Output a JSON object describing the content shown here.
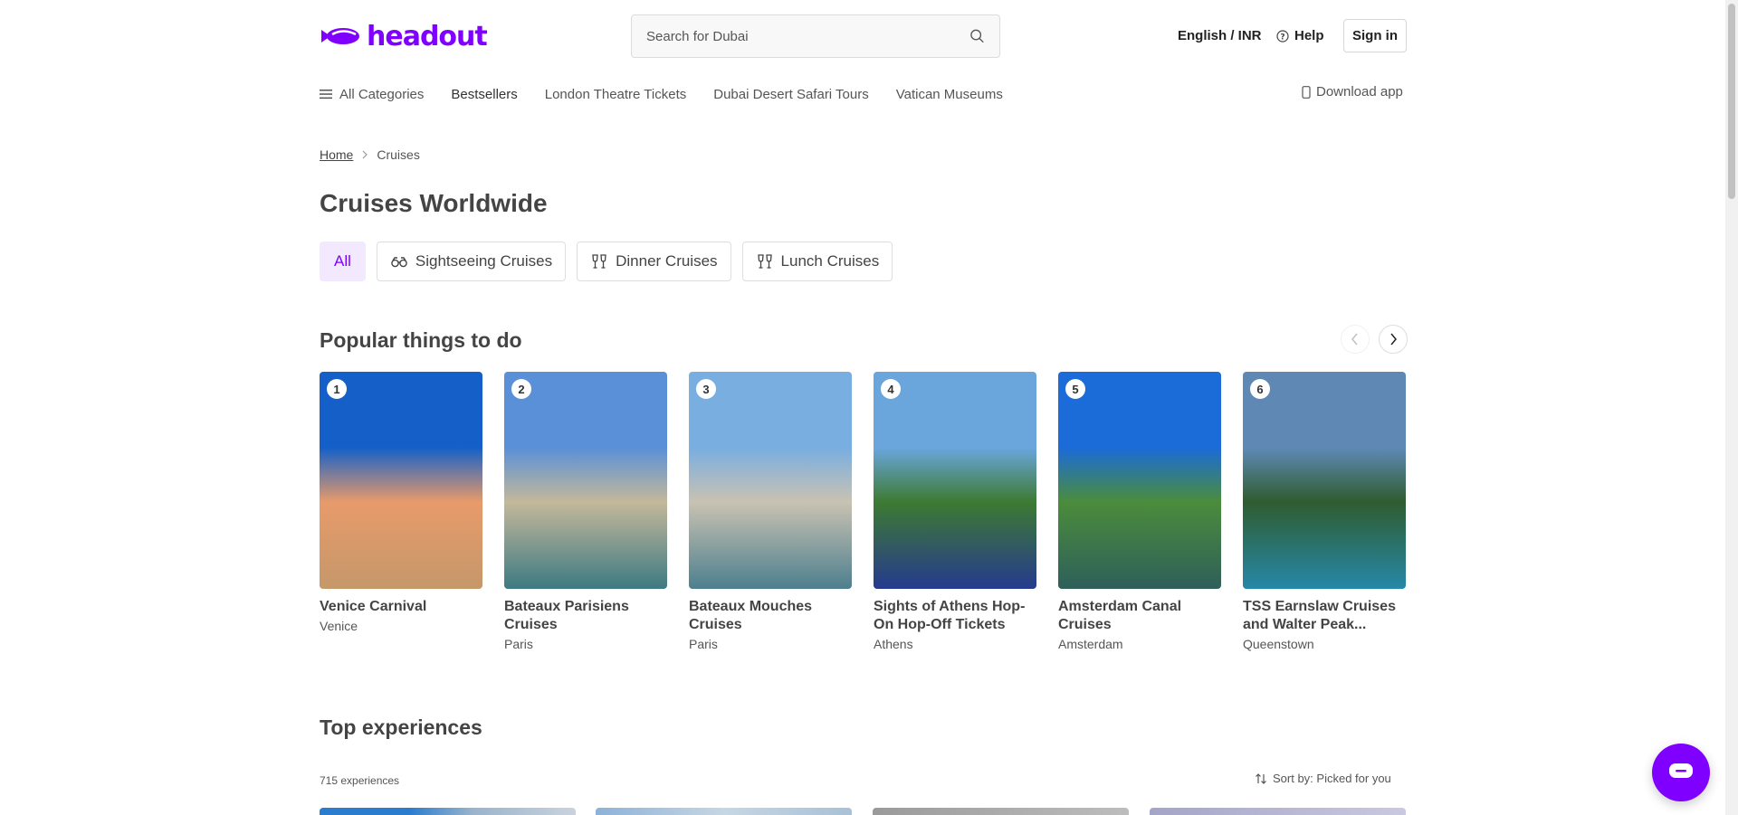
{
  "header": {
    "logo_text": "headout",
    "search_placeholder": "Search for Dubai",
    "language": "English / INR",
    "help": "Help",
    "sign_in": "Sign in"
  },
  "nav": {
    "all_categories": "All Categories",
    "items": [
      "Bestsellers",
      "London Theatre Tickets",
      "Dubai Desert Safari Tours",
      "Vatican Museums"
    ],
    "download_app": "Download app"
  },
  "breadcrumb": {
    "home": "Home",
    "current": "Cruises"
  },
  "page_title": "Cruises Worldwide",
  "filters": [
    "All",
    "Sightseeing Cruises",
    "Dinner Cruises",
    "Lunch Cruises"
  ],
  "popular": {
    "title": "Popular things to do",
    "cards": [
      {
        "rank": "1",
        "name": "Venice Carnival",
        "city": "Venice",
        "colors": [
          "#1560c8",
          "#e89a6a",
          "#c5986a"
        ]
      },
      {
        "rank": "2",
        "name": "Bateaux Parisiens Cruises",
        "city": "Paris",
        "colors": [
          "#5a90d8",
          "#c4b89a",
          "#3d7a82"
        ]
      },
      {
        "rank": "3",
        "name": "Bateaux Mouches Cruises",
        "city": "Paris",
        "colors": [
          "#79aee0",
          "#c9c2b2",
          "#4d7f8e"
        ]
      },
      {
        "rank": "4",
        "name": "Sights of Athens Hop-On Hop-Off Tickets",
        "city": "Athens",
        "colors": [
          "#6aa6dc",
          "#3d7a32",
          "#263a8e"
        ]
      },
      {
        "rank": "5",
        "name": "Amsterdam Canal Cruises",
        "city": "Amsterdam",
        "colors": [
          "#1b6bd8",
          "#4b8c3c",
          "#2e5f5a"
        ]
      },
      {
        "rank": "6",
        "name": "TSS Earnslaw Cruises and Walter Peak...",
        "city": "Queenstown",
        "colors": [
          "#5f89b4",
          "#2f5c30",
          "#2688a8"
        ]
      }
    ]
  },
  "top": {
    "title": "Top experiences",
    "count": "715 experiences",
    "sort": "Sort by: Picked for you"
  },
  "colors": {
    "brand": "#8000ff",
    "chip_active_bg": "#f3e9ff"
  }
}
